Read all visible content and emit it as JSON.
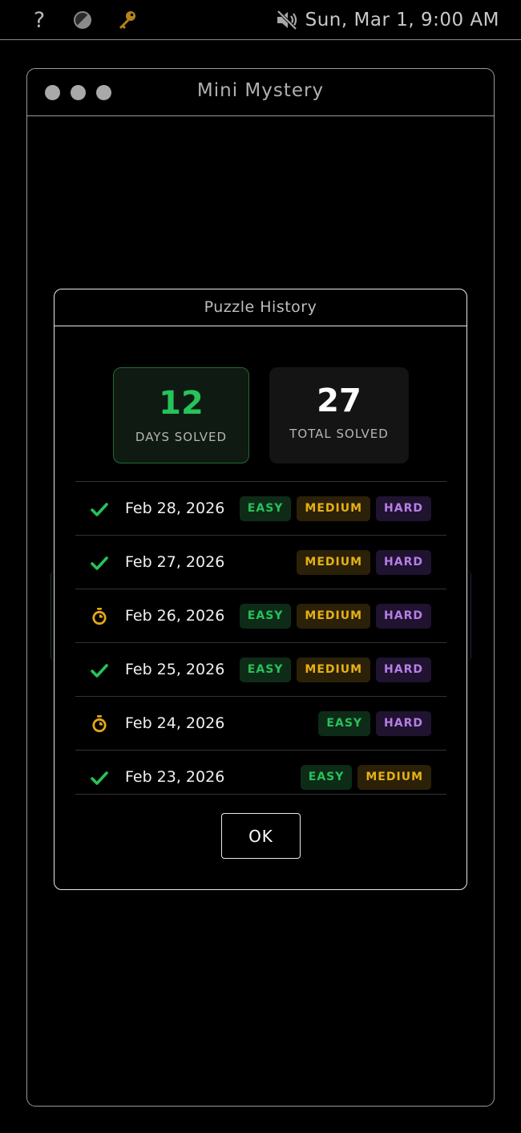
{
  "menubar": {
    "help_label": "?",
    "clock": "Sun, Mar 1, 9:00 AM",
    "icons": [
      "help-icon",
      "contrast-icon",
      "key-icon",
      "speaker-muted-icon"
    ]
  },
  "window": {
    "title": "Mini Mystery"
  },
  "dialog": {
    "title": "Puzzle History",
    "stats": {
      "days_solved_value": "12",
      "days_solved_label": "DAYS SOLVED",
      "total_solved_value": "27",
      "total_solved_label": "TOTAL SOLVED"
    },
    "history": [
      {
        "date": "Feb 28, 2026",
        "status": "solved",
        "badges": [
          "EASY",
          "MEDIUM",
          "HARD"
        ]
      },
      {
        "date": "Feb 27, 2026",
        "status": "solved",
        "badges": [
          "MEDIUM",
          "HARD"
        ]
      },
      {
        "date": "Feb 26, 2026",
        "status": "timed",
        "badges": [
          "EASY",
          "MEDIUM",
          "HARD"
        ]
      },
      {
        "date": "Feb 25, 2026",
        "status": "solved",
        "badges": [
          "EASY",
          "MEDIUM",
          "HARD"
        ]
      },
      {
        "date": "Feb 24, 2026",
        "status": "timed",
        "badges": [
          "EASY",
          "HARD"
        ]
      },
      {
        "date": "Feb 23, 2026",
        "status": "solved",
        "badges": [
          "EASY",
          "MEDIUM"
        ]
      }
    ],
    "ok_label": "OK"
  },
  "colors": {
    "easy": "#27c25a",
    "medium": "#e6b015",
    "hard": "#b77ee6",
    "check": "#27c25a",
    "timer": "#e6a817"
  }
}
